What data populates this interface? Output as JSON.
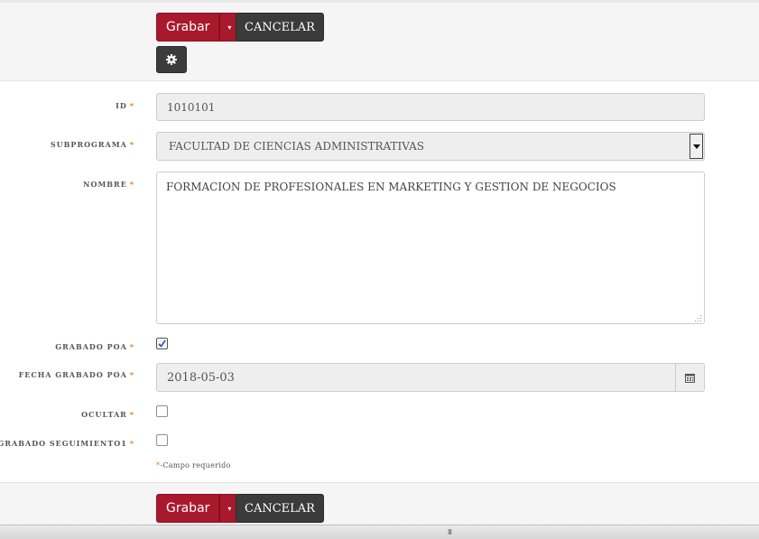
{
  "toolbar": {
    "save_label": "Grabar",
    "cancel_label": "CANCELAR",
    "caret": "▾"
  },
  "form": {
    "id_label": "ID",
    "id_value": "1010101",
    "subprograma_label": "SUBPROGRAMA",
    "subprograma_value": "FACULTAD DE CIENCIAS ADMINISTRATIVAS",
    "nombre_label": "NOMBRE",
    "nombre_value": "FORMACION DE PROFESIONALES EN MARKETING Y GESTION DE NEGOCIOS",
    "grabado_poa_label": "GRABADO POA",
    "grabado_poa_checked": true,
    "fecha_label": "FECHA GRABADO POA",
    "fecha_value": "2018-05-03",
    "ocultar_label": "OCULTAR",
    "ocultar_checked": false,
    "seguimiento_label": "GRABADO SEGUIMIENTO1",
    "seguimiento_checked": false,
    "required_marker": "*",
    "required_note": "-Campo requerido"
  },
  "icons": {
    "gear": "gear-icon",
    "calendar": "calendar-icon",
    "select_arrow": "select-arrow-icon"
  },
  "colors": {
    "save_button": "#a8192e",
    "cancel_button": "#3b3b3b",
    "required": "#e2731a"
  },
  "statusbar": {
    "handle": "III"
  }
}
